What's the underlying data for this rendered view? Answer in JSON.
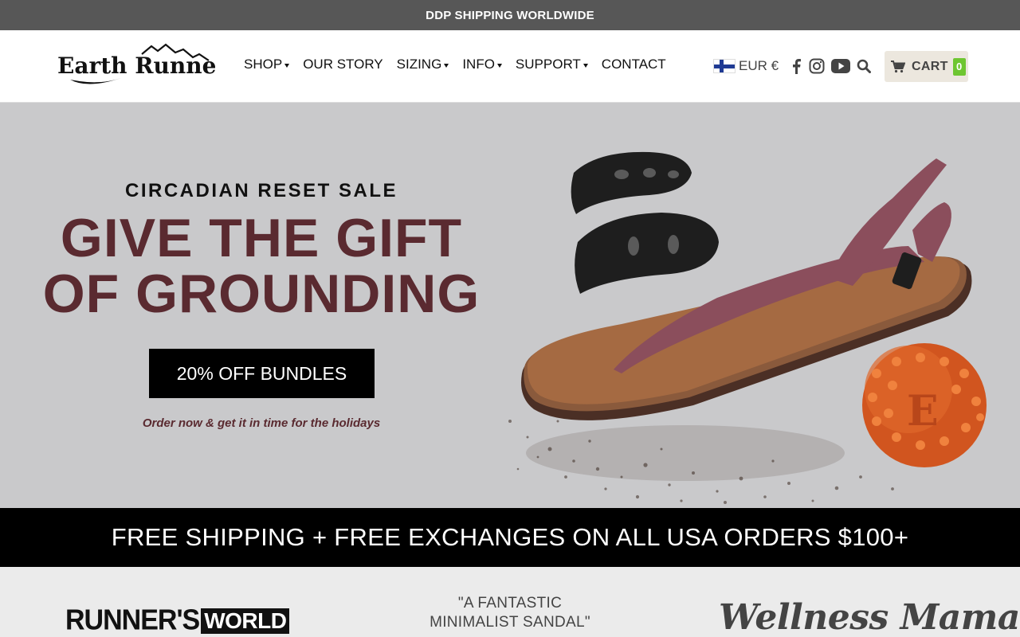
{
  "announcement": {
    "text": "DDP SHIPPING WORLDWIDE"
  },
  "header": {
    "logo_text": "Earth Runners",
    "nav": [
      {
        "label": "SHOP",
        "has_dropdown": true
      },
      {
        "label": "OUR STORY",
        "has_dropdown": false
      },
      {
        "label": "SIZING",
        "has_dropdown": true
      },
      {
        "label": "INFO",
        "has_dropdown": true
      },
      {
        "label": "SUPPORT",
        "has_dropdown": true
      },
      {
        "label": "CONTACT",
        "has_dropdown": false
      }
    ],
    "currency": "EUR €",
    "social_icons": [
      "facebook-icon",
      "instagram-icon",
      "youtube-icon"
    ],
    "cart": {
      "label": "CART",
      "count": "0",
      "badge_color": "#6ec631"
    }
  },
  "hero": {
    "eyebrow": "CIRCADIAN RESET SALE",
    "headline_line1": "GIVE THE GIFT",
    "headline_line2": "OF GROUNDING",
    "cta_label": "20% OFF BUNDLES",
    "subnote": "Order now & get it in time for the holidays",
    "accent_color": "#5a2a30",
    "background_color": "#c9c9cb"
  },
  "shipping_banner": {
    "text": "FREE SHIPPING + FREE EXCHANGES ON ALL USA ORDERS $100+"
  },
  "press": {
    "runners_world_a": "RUNNER'S",
    "runners_world_b": "WORLD",
    "quote_line1": "\"A FANTASTIC",
    "quote_line2": "MINIMALIST SANDAL\"",
    "wellness_mama": "Wellness Mama"
  }
}
